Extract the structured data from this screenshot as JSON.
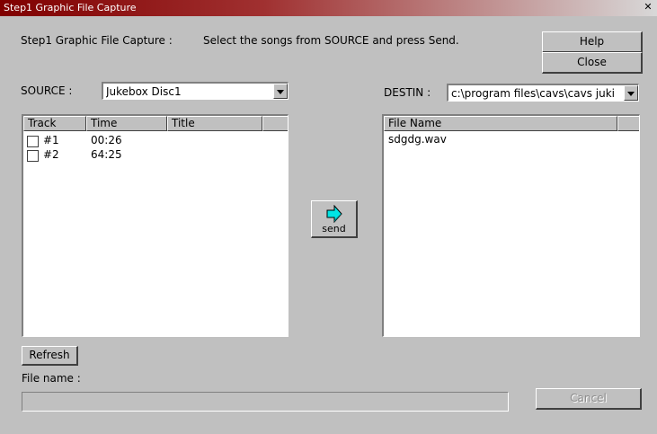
{
  "window": {
    "title": "Step1 Graphic File Capture"
  },
  "header": {
    "step_title": "Step1  Graphic File Capture :",
    "instruction": "Select the songs from SOURCE and press Send.",
    "help_label": "Help",
    "close_label": "Close"
  },
  "source": {
    "label": "SOURCE :",
    "selected": "Jukebox  Disc1",
    "columns": [
      "Track",
      "Time",
      "Title"
    ],
    "rows": [
      {
        "track": "#1",
        "time": "00:26",
        "title": ""
      },
      {
        "track": "#2",
        "time": "64:25",
        "title": ""
      }
    ],
    "refresh_label": "Refresh"
  },
  "send": {
    "label": "send"
  },
  "destination": {
    "label": "DESTIN :",
    "selected": "c:\\program files\\cavs\\cavs juki",
    "columns": [
      "File Name"
    ],
    "files": [
      "sdgdg.wav"
    ]
  },
  "footer": {
    "file_name_label": "File name :",
    "file_name_value": "",
    "cancel_label": "Cancel"
  },
  "colors": {
    "title_bar": "#800000",
    "face": "#c0c0c0",
    "send_arrow": "#00e5e5"
  }
}
